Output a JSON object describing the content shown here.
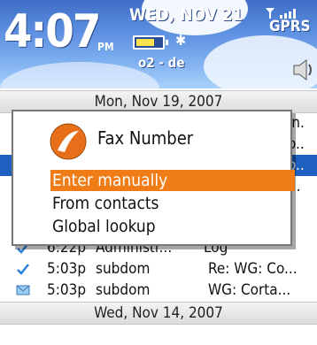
{
  "status_bar": {
    "time": "4:07",
    "ampm": "PM",
    "date": "WED, NOV 21",
    "network": "GPRS",
    "carrier": "o2 - de",
    "battery_level": 0.7
  },
  "day_headers": {
    "first": "Mon, Nov 19, 2007",
    "second": "Wed, Nov 14, 2007"
  },
  "messages": [
    {
      "time": "",
      "sender": "",
      "subject": "in.",
      "icon": "envelope-icon"
    },
    {
      "time": "",
      "sender": "",
      "subject": "o..",
      "icon": "envelope-icon"
    },
    {
      "time": "",
      "sender": "",
      "subject": "o..",
      "icon": "reply-icon"
    },
    {
      "time": "",
      "sender": "",
      "subject": "r..",
      "icon": "envelope-icon"
    },
    {
      "time": "6:22p",
      "sender": "Administr...",
      "subject": "Log",
      "icon": "checkmark-icon"
    },
    {
      "time": "5:03p",
      "sender": "subdom",
      "subject": "Re: WG: Co...",
      "icon": "checkmark-icon"
    },
    {
      "time": "5:03p",
      "sender": "subdom",
      "subject": "WG: Corta...",
      "icon": "envelope-icon"
    }
  ],
  "dialog": {
    "title": "Fax Number",
    "options": [
      "Enter manually",
      "From contacts",
      "Global lookup"
    ],
    "selected_index": 0
  }
}
